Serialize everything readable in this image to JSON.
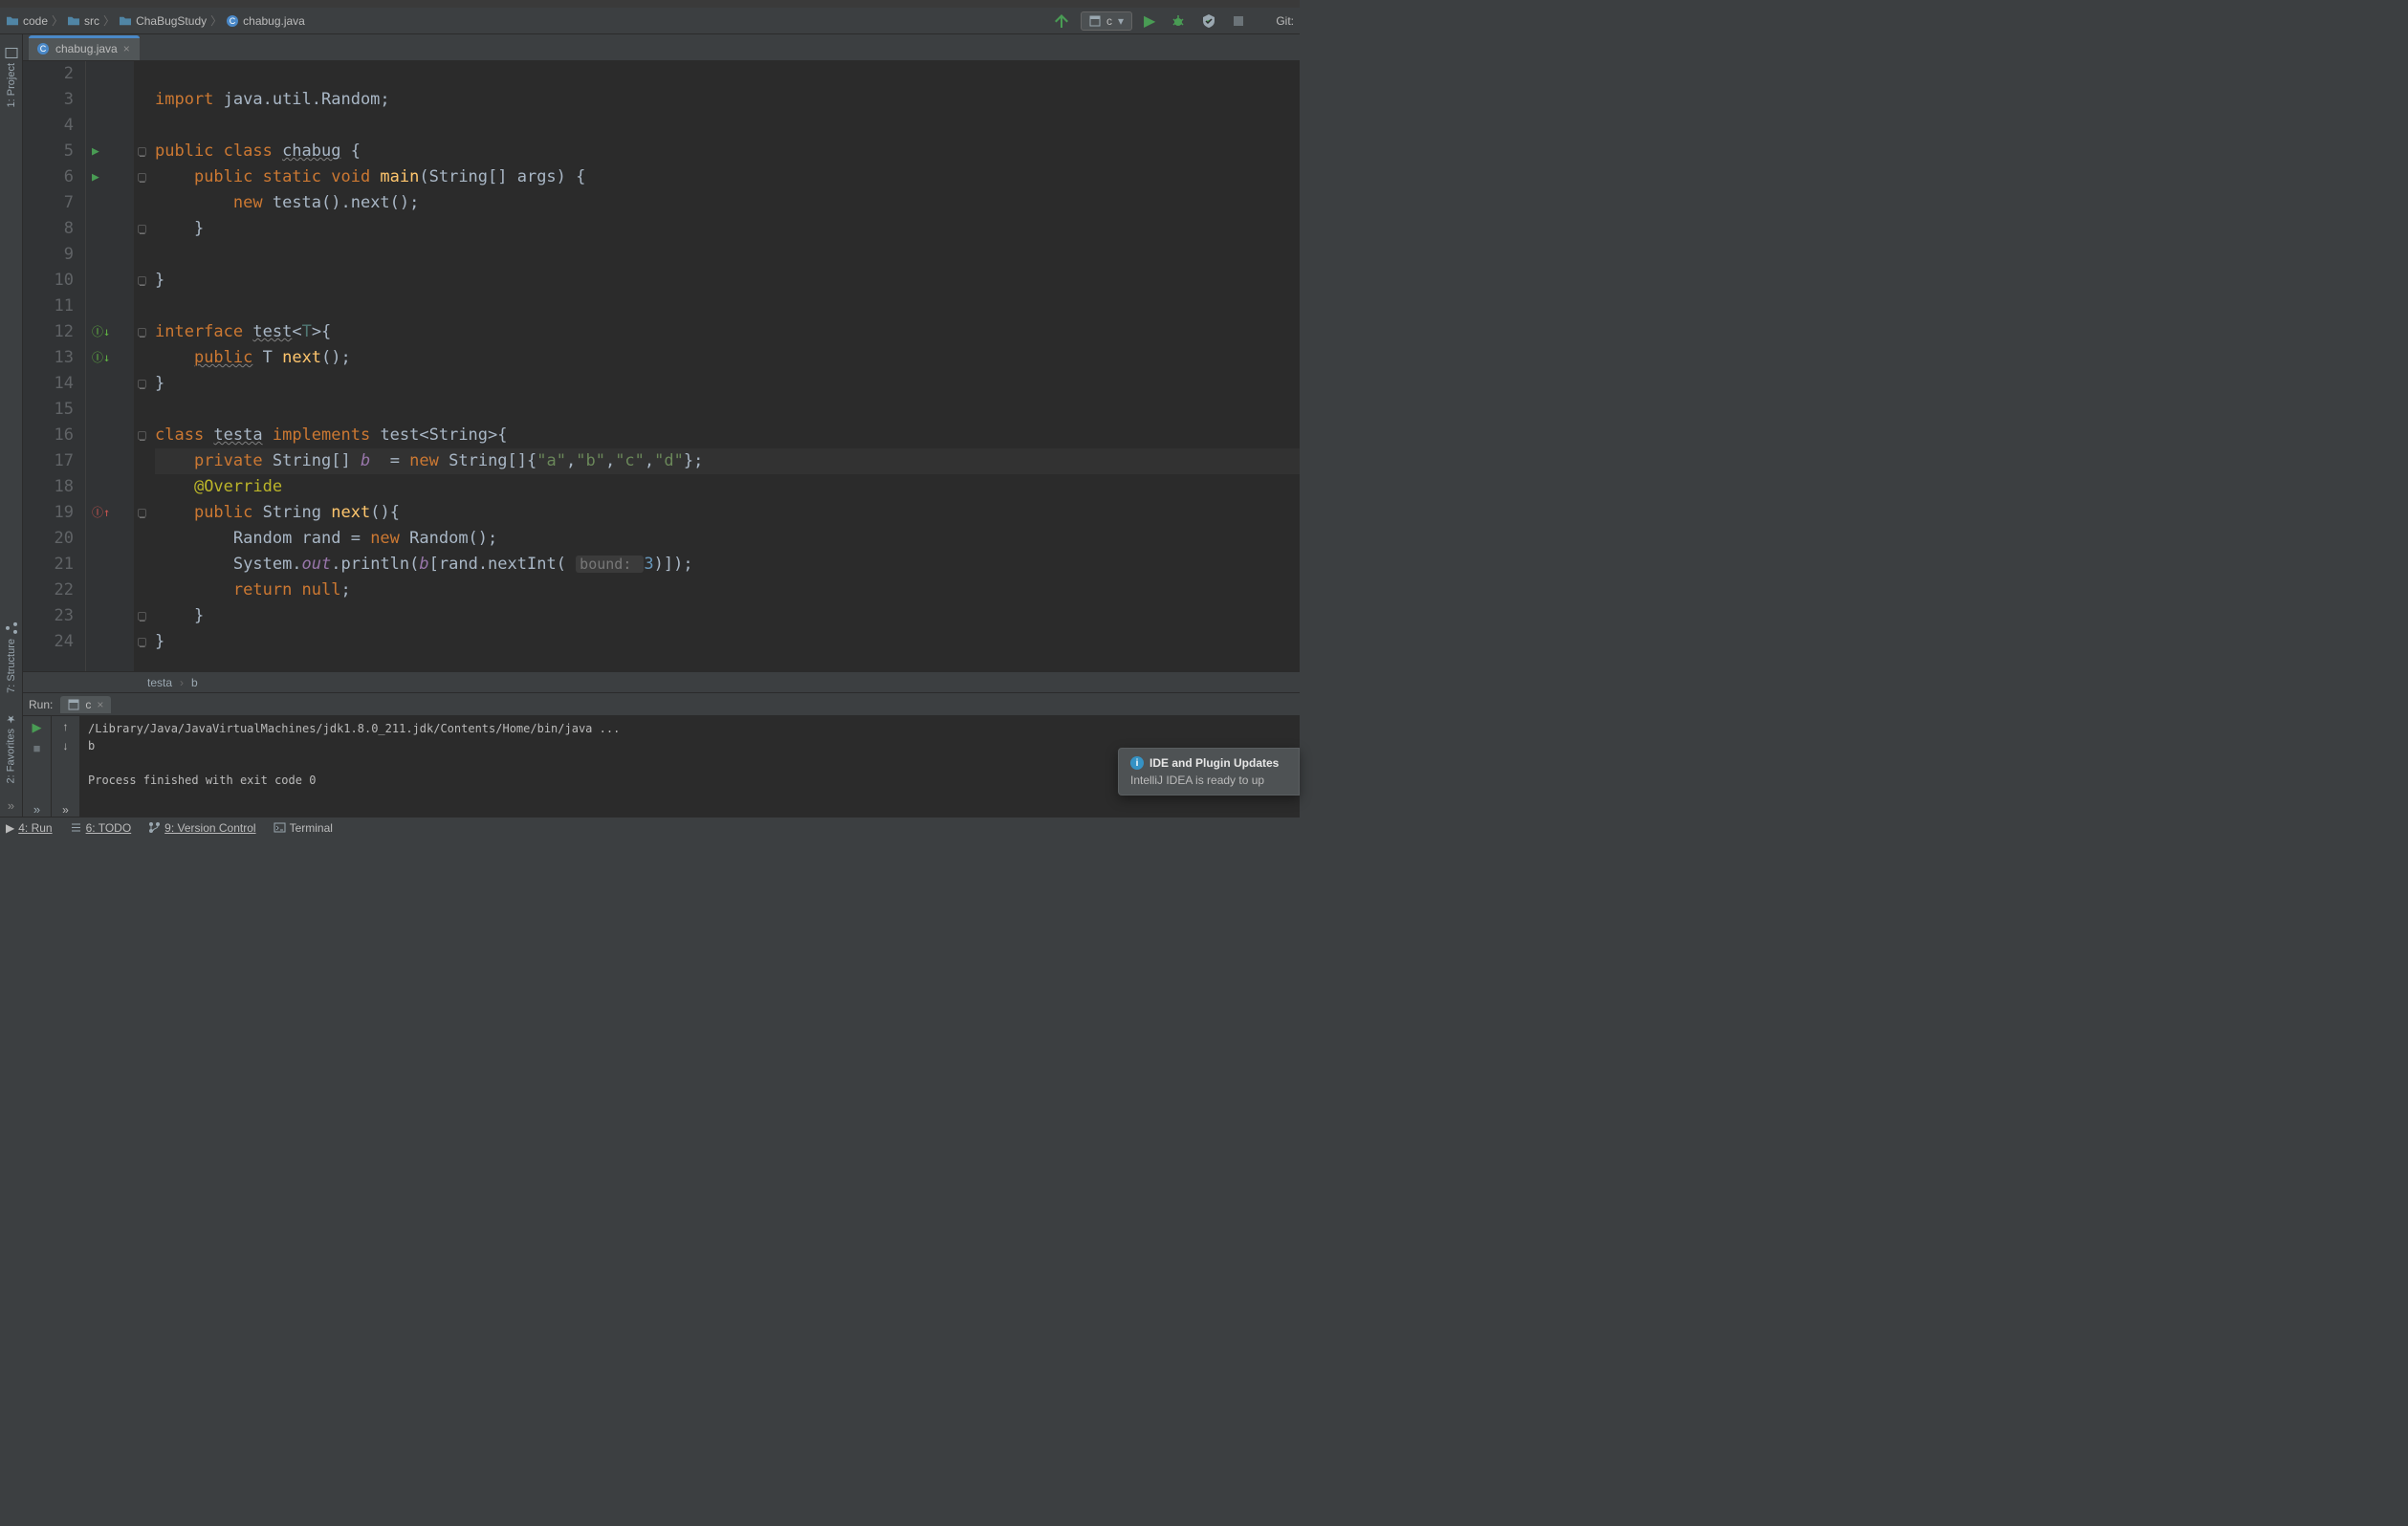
{
  "breadcrumbs": {
    "items": [
      "code",
      "src",
      "ChaBugStudy",
      "chabug.java"
    ]
  },
  "run_config": {
    "name": "c"
  },
  "nav": {
    "git_label": "Git:"
  },
  "editor": {
    "tab": {
      "name": "chabug.java"
    },
    "lines": {
      "start": 2,
      "end": 24
    },
    "code": {
      "l3_import": "import",
      "l3_pkg": " java.util.Random;",
      "l5a": "public class ",
      "l5_cls": "chabug",
      "l5b": " {",
      "l6a": "public static void ",
      "l6_m": "main",
      "l6b": "(String[] args) {",
      "l7a": "new ",
      "l7b": "testa().next();",
      "l8": "}",
      "l10": "}",
      "l12a": "interface ",
      "l12b": "test",
      "l12c": "<",
      "l12_T": "T",
      "l12d": ">{",
      "l13a": "public",
      "l13b": " T ",
      "l13_m": "next",
      "l13c": "();",
      "l14": "}",
      "l16a": "class ",
      "l16_cls": "testa",
      "l16b": " implements ",
      "l16c": "test<String>{",
      "l17a": "private ",
      "l17b": "String[] ",
      "l17_f": "b",
      "l17c": "  = ",
      "l17_new": "new ",
      "l17d": "String[]{",
      "l17_s1": "\"a\"",
      "l17_s2": "\"b\"",
      "l17_s3": "\"c\"",
      "l17_s4": "\"d\"",
      "l17e": "};",
      "l18": "@Override",
      "l19a": "public ",
      "l19b": "String ",
      "l19_m": "next",
      "l19c": "(){",
      "l20a": "Random rand = ",
      "l20_new": "new ",
      "l20b": "Random();",
      "l21a": "System.",
      "l21_out": "out",
      "l21b": ".println(",
      "l21_f": "b",
      "l21c": "[rand.nextInt( ",
      "l21_hint": "bound: ",
      "l21_num": "3",
      "l21d": ")]);",
      "l22a": "return null",
      "l22b": ";",
      "l23": "}",
      "l24": "}"
    },
    "context_crumb": {
      "a": "testa",
      "b": "b"
    }
  },
  "run_panel": {
    "title": "Run:",
    "tab": "c",
    "console": {
      "line1": "/Library/Java/JavaVirtualMachines/jdk1.8.0_211.jdk/Contents/Home/bin/java ...",
      "line2": "b",
      "line3": "",
      "line4": "Process finished with exit code 0"
    }
  },
  "statusbar": {
    "run": "4: Run",
    "todo": "6: TODO",
    "vcs": "9: Version Control",
    "terminal": "Terminal"
  },
  "leftstrip": {
    "project": "1: Project",
    "structure": "7: Structure",
    "favorites": "2: Favorites"
  },
  "notify": {
    "title": "IDE and Plugin Updates",
    "body": "IntelliJ IDEA is ready to up"
  }
}
